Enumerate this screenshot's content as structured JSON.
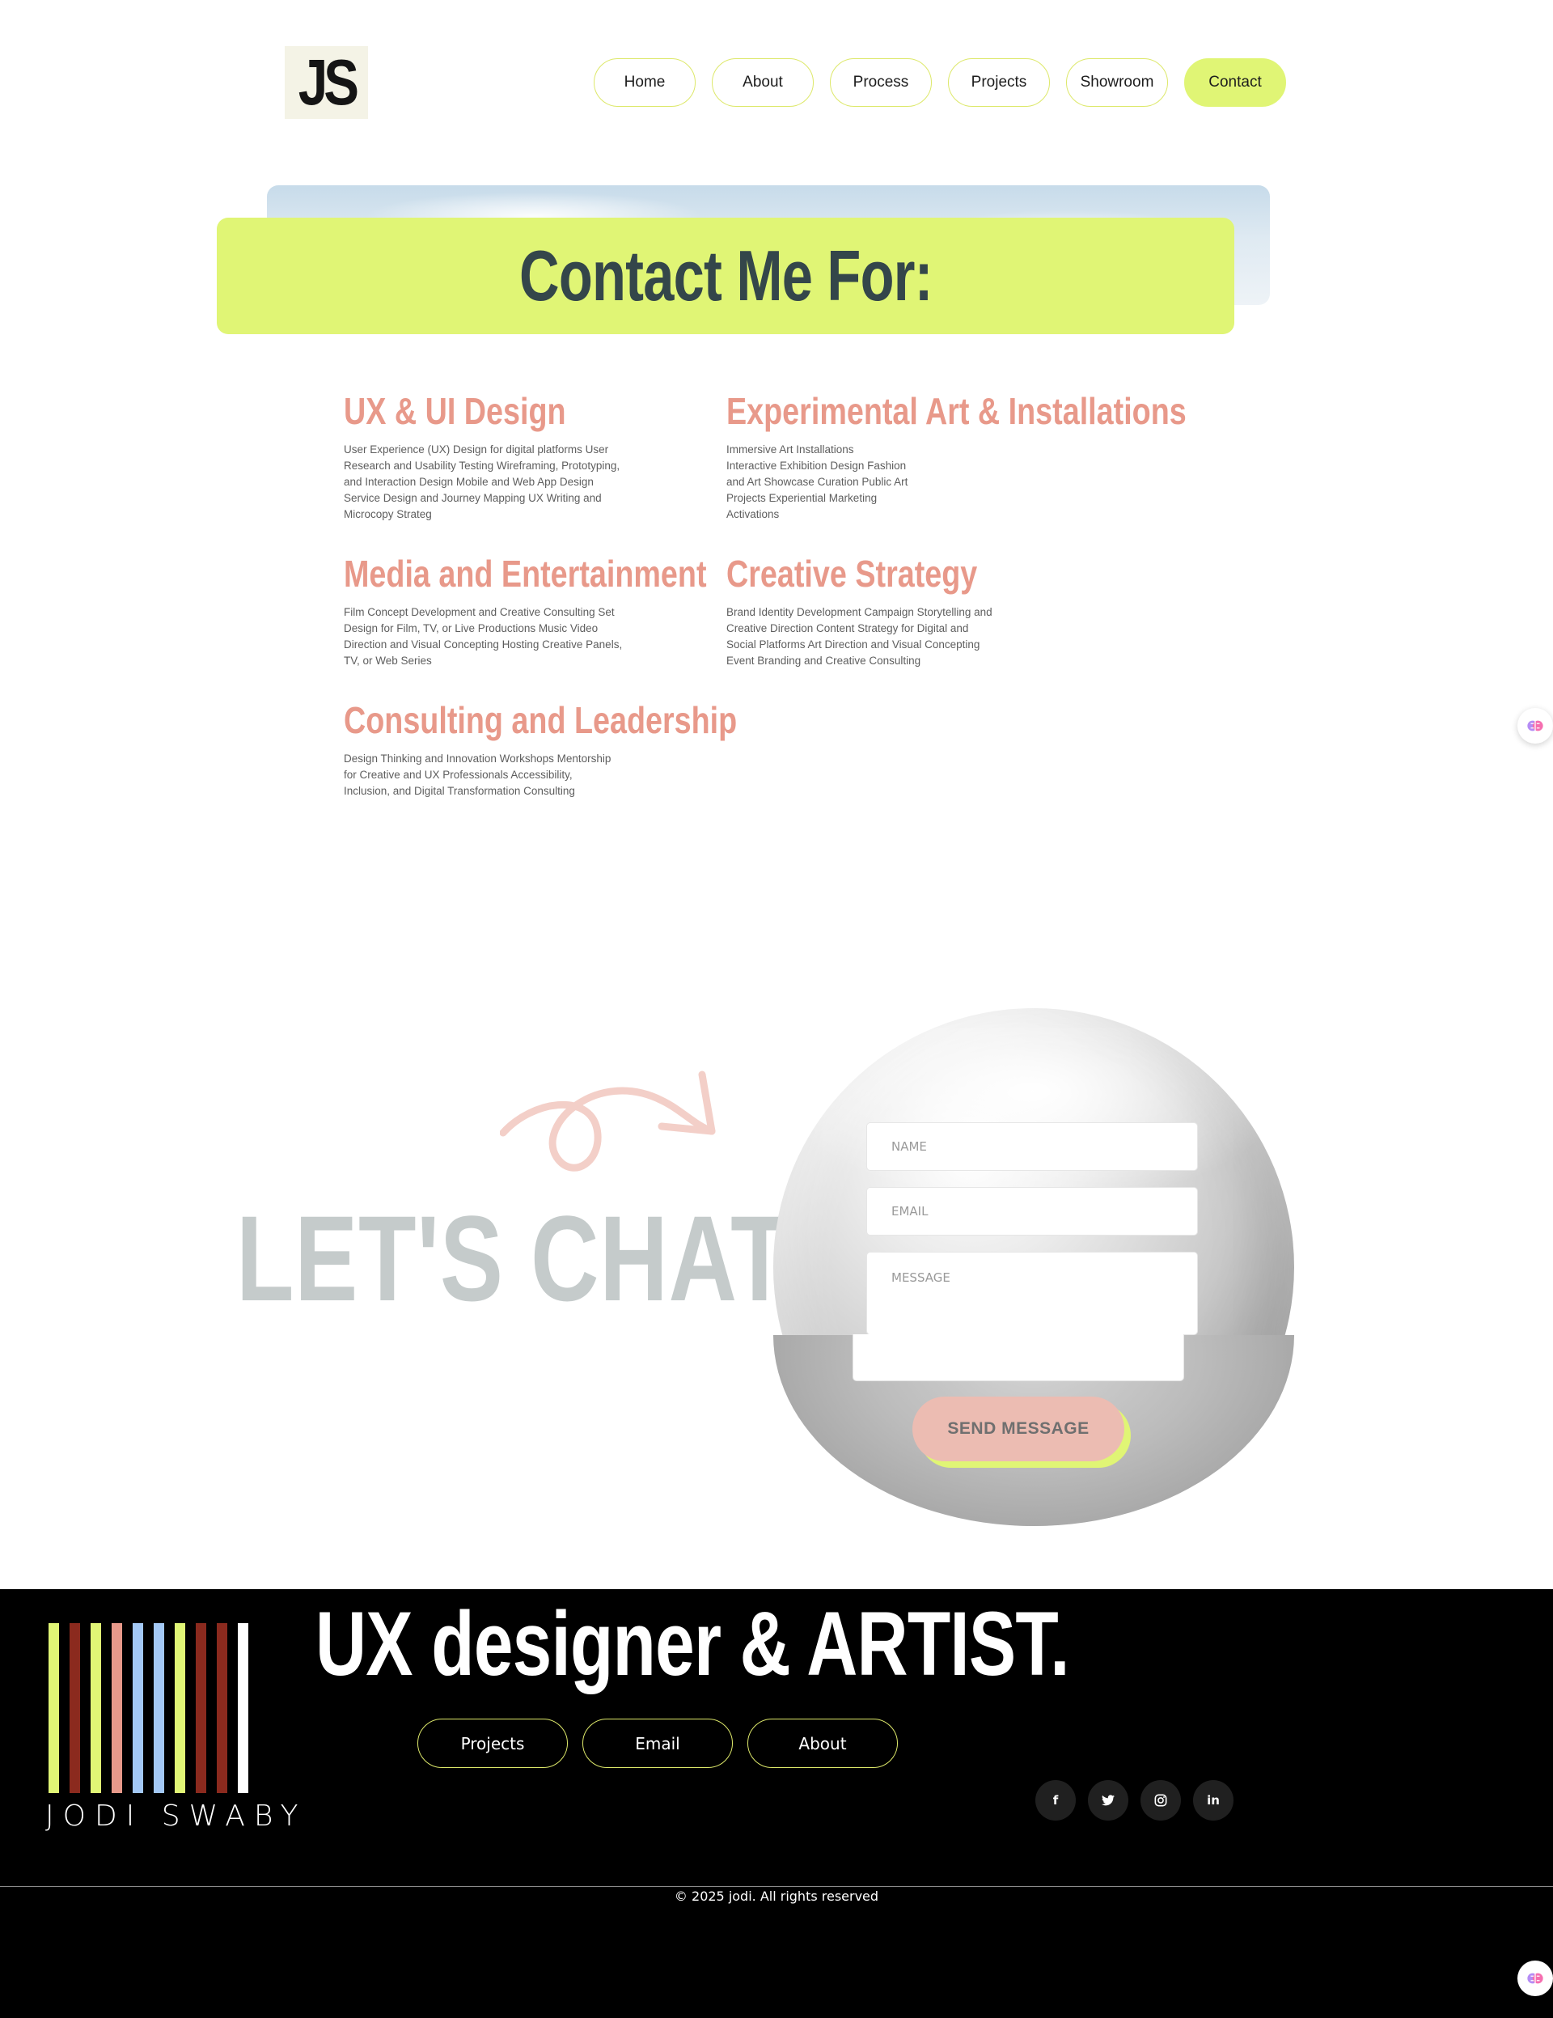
{
  "header": {
    "logo_text": "JS",
    "nav": [
      {
        "label": "Home",
        "active": false
      },
      {
        "label": "About",
        "active": false
      },
      {
        "label": "Process",
        "active": false
      },
      {
        "label": "Projects",
        "active": false
      },
      {
        "label": "Showroom",
        "active": false
      },
      {
        "label": "Contact",
        "active": true
      }
    ]
  },
  "hero": {
    "title": "Contact Me For:"
  },
  "services": [
    {
      "title": "UX & UI Design",
      "lines": [
        "User Experience (UX) Design for digital platforms User",
        "Research and Usability Testing Wireframing, Prototyping,",
        "and Interaction Design Mobile and Web App Design",
        "Service Design and Journey Mapping UX Writing and",
        "Microcopy Strateg"
      ]
    },
    {
      "title": "Experimental Art & Installations",
      "lines": [
        "Immersive Art Installations",
        "Interactive Exhibition Design Fashion",
        "and Art Showcase Curation Public Art",
        "Projects Experiential Marketing",
        "Activations"
      ]
    },
    {
      "title": "Media and Entertainment",
      "lines": [
        "Film Concept Development and Creative Consulting Set",
        "Design for Film, TV, or Live Productions Music Video",
        "Direction and Visual Concepting Hosting Creative Panels,",
        "TV, or Web Series"
      ]
    },
    {
      "title": "Creative Strategy",
      "lines": [
        "Brand Identity Development Campaign Storytelling and",
        "Creative Direction Content Strategy for Digital and",
        "Social Platforms Art Direction and Visual Concepting",
        "Event Branding and Creative Consulting"
      ]
    },
    {
      "title": "Consulting and Leadership",
      "lines": [
        "Design Thinking and Innovation Workshops Mentorship",
        "for Creative and UX Professionals Accessibility,",
        "Inclusion, and Digital Transformation Consulting"
      ]
    }
  ],
  "chat": {
    "title": "LET'S CHAT",
    "name_placeholder": "NAME",
    "email_placeholder": "EMAIL",
    "message_placeholder": "MESSAGE",
    "send_label": "SEND MESSAGE"
  },
  "footer": {
    "brand": "JODI SWABY",
    "title": "UX designer & ARTIST.",
    "links": [
      "Projects",
      "Email",
      "About"
    ],
    "socials": [
      {
        "icon": "facebook-icon",
        "glyph": "f"
      },
      {
        "icon": "twitter-icon",
        "glyph": "t"
      },
      {
        "icon": "instagram-icon",
        "glyph": "◎"
      },
      {
        "icon": "linkedin-icon",
        "glyph": "in"
      }
    ],
    "copyright": "© 2025 jodi. All rights reserved"
  },
  "colors": {
    "accent_lime": "#e0f575",
    "heading_salmon": "#e8998a",
    "hero_text": "#34464a",
    "footer_bg": "#000000",
    "stripes": [
      "#e0f575",
      "#8b2a1e",
      "#e0f575",
      "#e8998a",
      "#a3c8f5",
      "#a3c8f5",
      "#e0f575",
      "#8b2a1e",
      "#8b2a1e",
      "#ffffff"
    ]
  }
}
